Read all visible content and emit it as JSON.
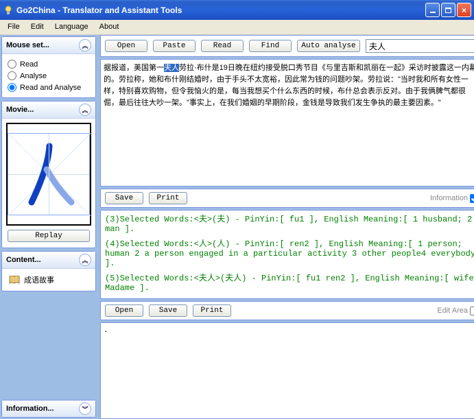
{
  "window": {
    "title": "Go2China - Translator and Assistant Tools"
  },
  "menu": {
    "file": "File",
    "edit": "Edit",
    "language": "Language",
    "about": "About"
  },
  "sidebar": {
    "mouse": {
      "title": "Mouse set...",
      "opt_read": "Read",
      "opt_analyse": "Analyse",
      "opt_read_analyse": "Read and Analyse"
    },
    "movie": {
      "title": "Movie...",
      "replay": "Replay"
    },
    "content": {
      "title": "Content...",
      "item1": "成语故事"
    },
    "information": {
      "title": "Information..."
    }
  },
  "toolbar": {
    "open": "Open",
    "paste": "Paste",
    "read": "Read",
    "find": "Find",
    "auto_analyse": "Auto analyse",
    "search_value": "夫人"
  },
  "main_text": {
    "before_hl": "据报道，美国第一",
    "hl": "夫人",
    "after_hl": "劳拉·布什是19日晚在纽约接受脱口秀节目《与里吉斯和凯丽在一起》采访时披露这一内幕的。劳拉称，她和布什刚结婚时，由于手头不太宽裕，因此常为钱的问题吵架。劳拉说：\"当时我和所有女性一样，特别喜欢购物，但令我恼火的是，每当我想买个什么东西的时候，布什总会表示反对。由于我俩脾气都很倔，最后往往大吵一架。\"事实上，在我们婚姻的早期阶段，金钱是导致我们发生争执的最主要因素。\""
  },
  "midbar": {
    "save": "Save",
    "print": "Print",
    "info_label": "Information"
  },
  "info": {
    "line3": "(3)Selected Words:<夫>(夫) - PinYin:[ fu1 ], English Meaning:[ 1 husband;  2 man ].",
    "line4": "(4)Selected Words:<人>(人) - PinYin:[ ren2 ], English Meaning:[ 1 person; human 2 a person engaged in a particular activity 3 other people4 everybody ].",
    "line5": "(5)Selected Words:<夫人>(夫人) - PinYin:[ fu1 ren2 ], English Meaning:[ wife;  Madame ]."
  },
  "editbar": {
    "open": "Open",
    "save": "Save",
    "print": "Print",
    "label": "Edit Area"
  },
  "editpane": {
    "content": "."
  }
}
